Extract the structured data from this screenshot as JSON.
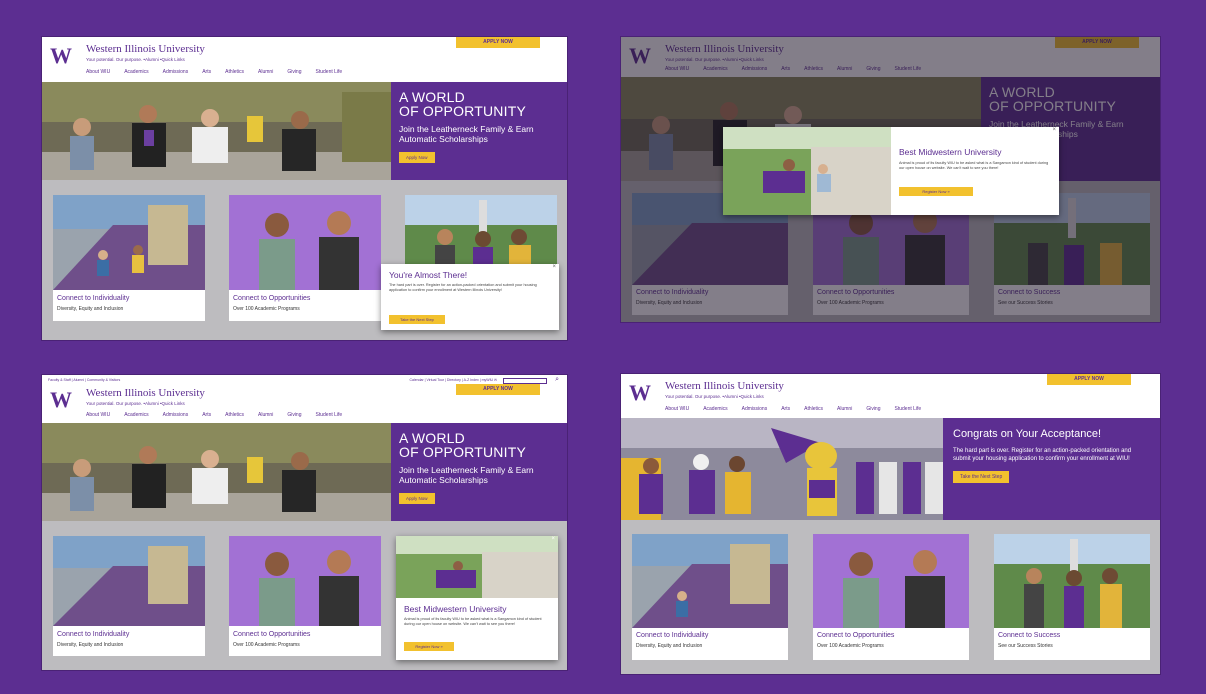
{
  "site": {
    "wordmark": "W",
    "name": "Western Illinois University",
    "tagline": "Your potential. Our purpose.  •Alumni  •Quick Links",
    "apply_label": "APPLY NOW",
    "nav": [
      "About WIU",
      "Academics",
      "Admissions",
      "Arts",
      "Athletics",
      "Alumni",
      "Giving",
      "Student Life"
    ]
  },
  "utility_bar": {
    "left": "Faculty & Staff  |  Alumni  |  Community & Visitors",
    "right": "Calendar  |  Virtual Tour  |  Directory  |  A-Z Index  |  myWIU  ✉"
  },
  "hero": {
    "title_line1": "A WORLD",
    "title_line2": "OF OPPORTUNITY",
    "subtitle": "Join the Leatherneck Family & Earn Automatic Scholarships",
    "button": "Apply Now"
  },
  "hero_congrats": {
    "title": "Congrats on Your Acceptance!",
    "body": "The hard part is over. Register for an action-packed orientation and submit your housing application to confirm your enrollment at WIU!",
    "button": "Take the Next Step"
  },
  "cards": [
    {
      "title": "Connect to Individuality",
      "subtitle": "Diversity, Equity and Inclusion"
    },
    {
      "title": "Connect to Opportunities",
      "subtitle": "Over 100 Academic Programs"
    },
    {
      "title": "Connect to Success",
      "subtitle": "See our Success Stories"
    }
  ],
  "modal_almost": {
    "title": "You're Almost There!",
    "body": "The hard part is over. Register for an action-packed orientation and submit your housing application to confirm your enrollment at Western Illinois University!",
    "button": "Take the Next Step",
    "close": "×"
  },
  "modal_midwestern": {
    "title": "Best Midwestern University",
    "body": "Animal is proud of its faculty WIU to be asked what is a Sangamon kind of student during our open house on website. We can't wait to see you there!",
    "button": "Register Now  »",
    "close": "×"
  },
  "colors": {
    "purple": "#5c2e91",
    "gold": "#f2c12e",
    "gray_band": "#bdbcbf"
  }
}
